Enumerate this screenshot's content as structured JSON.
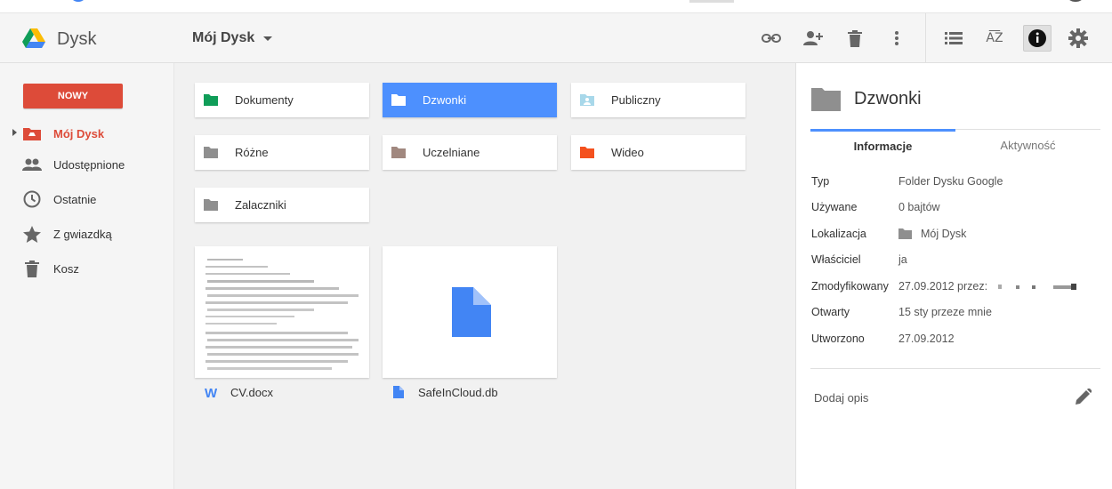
{
  "header": {
    "app_title": "Dysk",
    "breadcrumb": "Mój Dysk",
    "icons": [
      "link-icon",
      "add-person-icon",
      "trash-icon",
      "more-vert-icon",
      "list-view-icon",
      "sort-az-icon",
      "info-icon",
      "settings-icon"
    ]
  },
  "sidebar": {
    "new_label": "NOWY",
    "items": [
      {
        "label": "Mój Dysk",
        "icon": "drive-folder-icon",
        "active": true
      },
      {
        "label": "Udostępnione",
        "icon": "people-icon"
      },
      {
        "label": "Ostatnie",
        "icon": "clock-icon"
      },
      {
        "label": "Z gwiazdką",
        "icon": "star-icon"
      },
      {
        "label": "Kosz",
        "icon": "trash-icon"
      }
    ]
  },
  "folders": [
    {
      "name": "Dokumenty",
      "color": "#0f9d58"
    },
    {
      "name": "Dzwonki",
      "color": "#ffffff",
      "selected": true
    },
    {
      "name": "Publiczny",
      "color": "#a8d8ea"
    },
    {
      "name": "Różne",
      "color": "#8f8f8f"
    },
    {
      "name": "Uczelniane",
      "color": "#a1887f"
    },
    {
      "name": "Wideo",
      "color": "#f4511e"
    },
    {
      "name": "Zalaczniki",
      "color": "#8f8f8f"
    }
  ],
  "files": [
    {
      "name": "CV.docx",
      "icon": "word-doc-icon"
    },
    {
      "name": "SafeInCloud.db",
      "icon": "file-icon"
    }
  ],
  "details": {
    "title": "Dzwonki",
    "tabs": [
      "Informacje",
      "Aktywność"
    ],
    "props": {
      "type_key": "Typ",
      "type_val": "Folder Dysku Google",
      "used_key": "Używane",
      "used_val": "0 bajtów",
      "loc_key": "Lokalizacja",
      "loc_val": "Mój Dysk",
      "owner_key": "Właściciel",
      "owner_val": "ja",
      "mod_key": "Zmodyfikowany",
      "mod_val": "27.09.2012 przez:",
      "open_key": "Otwarty",
      "open_val": "15 sty przeze mnie",
      "created_key": "Utworzono",
      "created_val": "27.09.2012"
    },
    "description_label": "Dodaj opis"
  },
  "colors": {
    "accent": "#dd4b39",
    "selected": "#4d90fe",
    "drive_blue": "#4285f4"
  }
}
